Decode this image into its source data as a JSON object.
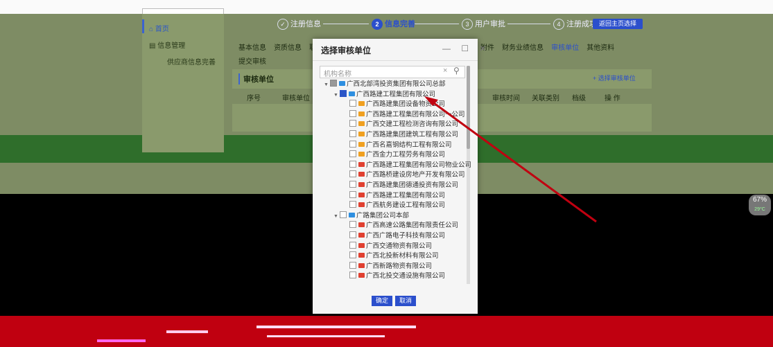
{
  "sidebar": {
    "items": [
      {
        "label": "首页",
        "icon": "home-icon"
      },
      {
        "label": "信息管理",
        "icon": "list-icon"
      },
      {
        "label": "供应商信息完善"
      }
    ]
  },
  "steps": [
    {
      "num": "✓",
      "label": "注册信息"
    },
    {
      "num": "2",
      "label": "信息完善"
    },
    {
      "num": "3",
      "label": "用户审批"
    },
    {
      "num": "4",
      "label": "注册成功"
    }
  ],
  "back_button": "返回主页选择",
  "tabs": [
    "基本信息",
    "资质信息",
    "职"
  ],
  "tabs_right": [
    "附件",
    "财务业绩信息",
    "审核单位",
    "其他资料"
  ],
  "active_tab": "审核单位",
  "submit_tab": "提交审核",
  "audit": {
    "title": "审核单位",
    "select_button": "+ 选择审核单位",
    "columns": [
      "序号",
      "审核单位",
      "审核时间",
      "关联类别",
      "档级",
      "操 作"
    ]
  },
  "modal": {
    "title": "选择审核单位",
    "controls": "— ☐ ✕",
    "search_placeholder": "机构名称",
    "tree": [
      {
        "label": "广西北部湾投资集团有限公司总部",
        "level": 0,
        "checkbox": "partial",
        "folder": "blue",
        "expanded": true
      },
      {
        "label": "广西路建工程集团有限公司",
        "level": 1,
        "checkbox": "checked",
        "folder": "blue",
        "expanded": true
      },
      {
        "label": "广西路建集团设备物资公司",
        "level": 2,
        "checkbox": "none",
        "folder": "orange"
      },
      {
        "label": "广西路建工程集团有限公司一公司",
        "level": 2,
        "checkbox": "none",
        "folder": "orange"
      },
      {
        "label": "广西交建工程检测咨询有限公司",
        "level": 2,
        "checkbox": "none",
        "folder": "orange"
      },
      {
        "label": "广西路建集团建筑工程有限公司",
        "level": 2,
        "checkbox": "none",
        "folder": "orange"
      },
      {
        "label": "广西名嘉钢结构工程有限公司",
        "level": 2,
        "checkbox": "none",
        "folder": "orange"
      },
      {
        "label": "广西金力工程劳务有限公司",
        "level": 2,
        "checkbox": "none",
        "folder": "orange"
      },
      {
        "label": "广西路建工程集团有限公司物业公司",
        "level": 2,
        "checkbox": "none",
        "folder": "red"
      },
      {
        "label": "广西路桥建设房地产开发有限公司",
        "level": 2,
        "checkbox": "none",
        "folder": "red"
      },
      {
        "label": "广西路建集团德通投资有限公司",
        "level": 2,
        "checkbox": "none",
        "folder": "red"
      },
      {
        "label": "广西路建工程集团有限公司",
        "level": 2,
        "checkbox": "none",
        "folder": "red"
      },
      {
        "label": "广西航务建设工程有限公司",
        "level": 2,
        "checkbox": "none",
        "folder": "red"
      },
      {
        "label": "广路集团公司本部",
        "level": 1,
        "checkbox": "none",
        "folder": "blue",
        "expanded": true
      },
      {
        "label": "广西高速公路集团有限责任公司",
        "level": 2,
        "checkbox": "none",
        "folder": "red"
      },
      {
        "label": "广西广路电子科技有限公司",
        "level": 2,
        "checkbox": "none",
        "folder": "red"
      },
      {
        "label": "广西交通物资有限公司",
        "level": 2,
        "checkbox": "none",
        "folder": "red"
      },
      {
        "label": "广西北投新材料有限公司",
        "level": 2,
        "checkbox": "none",
        "folder": "red"
      },
      {
        "label": "广西新路物资有限公司",
        "level": 2,
        "checkbox": "none",
        "folder": "red"
      },
      {
        "label": "广西北投交通设施有限公司",
        "level": 2,
        "checkbox": "none",
        "folder": "red"
      }
    ],
    "ok_label": "确定",
    "cancel_label": "取消"
  },
  "zoom": {
    "value": "67%",
    "sub": "29°C"
  },
  "colors": {
    "accent": "#2b4fcc",
    "arrow": "#c00010",
    "overlay": "#7e8c64"
  }
}
